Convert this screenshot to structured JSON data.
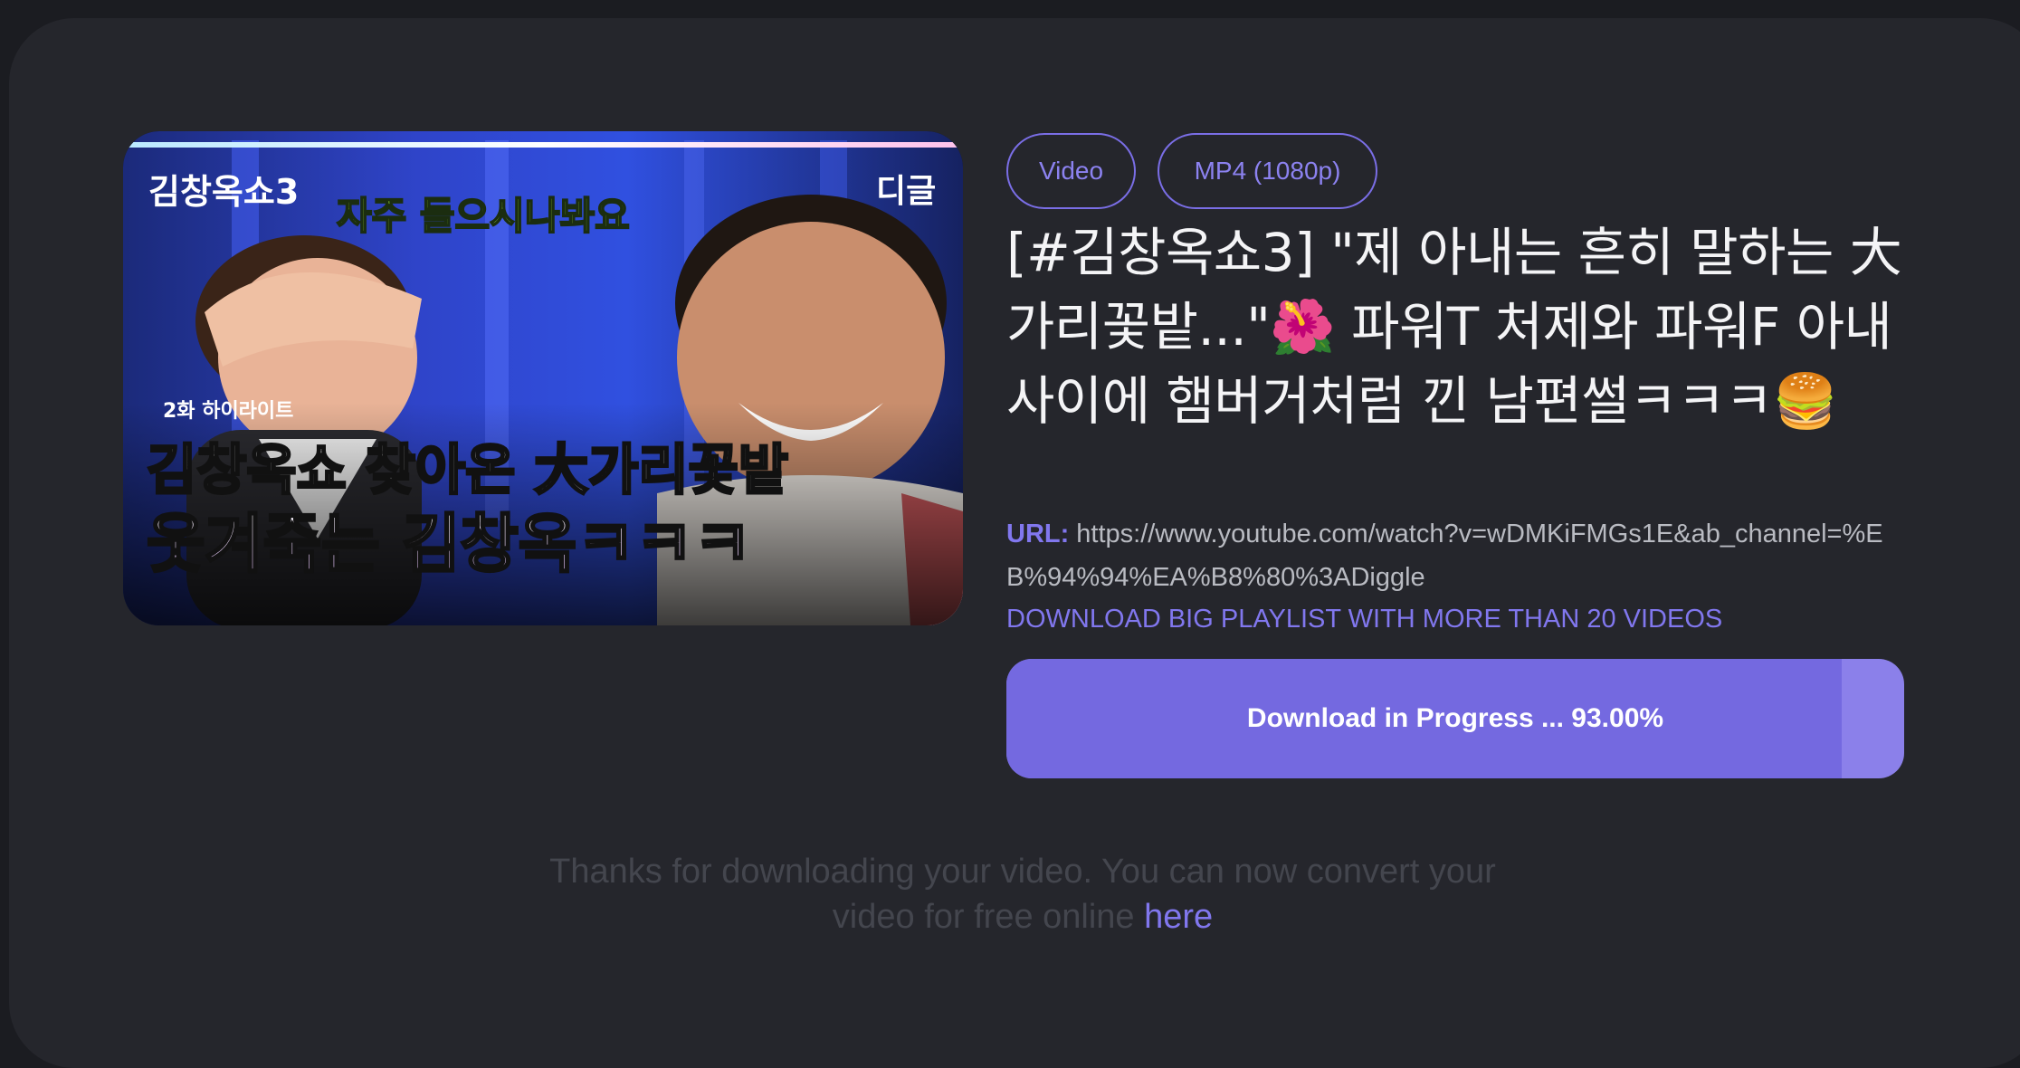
{
  "media": {
    "tags": [
      "Video",
      "MP4 (1080p)"
    ],
    "thumbnail": {
      "show_logo": "김창옥쇼3",
      "channel_logo": "디글",
      "speech_bubble": "자주 들으시나봐요",
      "episode_badge": "2화 하이라이트",
      "caption_line1": "김창옥쇼 찾아온 大가리꽃밭",
      "caption_line2": "웃겨죽는 김창옥ㅋㅋㅋ"
    },
    "title": "[#김창옥쇼3] \"제 아내는 흔히 말하는 大가리꽃밭...\"🌺 파워T 처제와 파워F 아내 사이에 햄버거처럼 낀 남편썰ㅋㅋㅋ🍔",
    "url_label": "URL:",
    "url": "https://www.youtube.com/watch?v=wDMKiFMGs1E&ab_channel=%EB%94%94%EA%B8%80%3ADiggle",
    "playlist_link": "DOWNLOAD BIG PLAYLIST WITH MORE THAN 20 VIDEOS"
  },
  "download": {
    "progress_label": "Download in Progress ... 93.00%",
    "progress_fraction": 0.93
  },
  "footer": {
    "thanks_text": "Thanks for downloading your video. You can now convert your video for free online ",
    "here_link": "here"
  },
  "colors": {
    "accent": "#7469e0",
    "background": "#1b1c21",
    "card": "#25262c"
  }
}
